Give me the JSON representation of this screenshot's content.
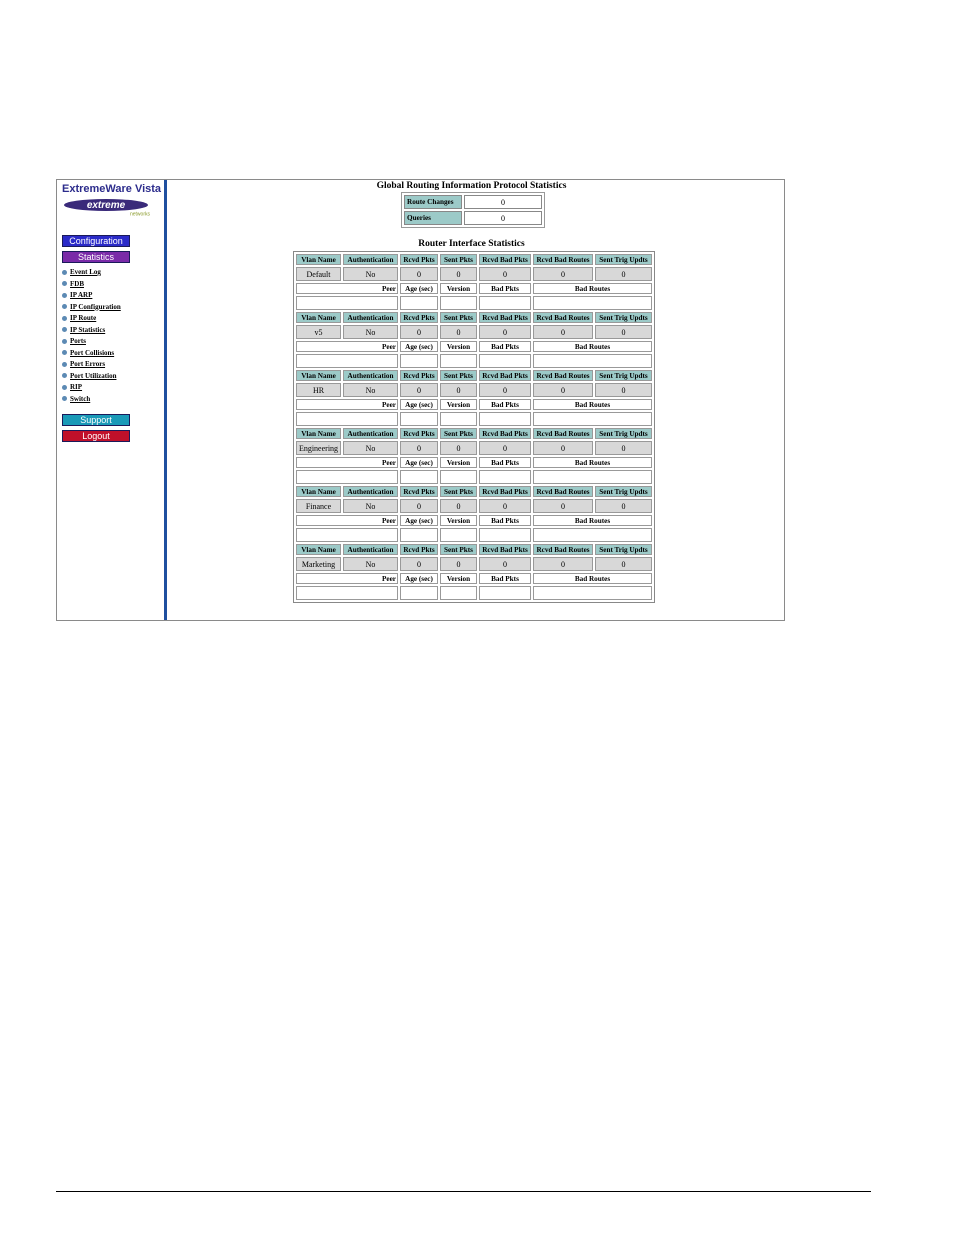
{
  "sidebar": {
    "brand": "ExtremeWare Vista",
    "logo_text": "extreme",
    "logo_sub": "networks",
    "configuration_label": "Configuration",
    "statistics_label": "Statistics",
    "support_label": "Support",
    "logout_label": "Logout",
    "items": [
      {
        "label": "Event Log"
      },
      {
        "label": "FDB"
      },
      {
        "label": "IP ARP"
      },
      {
        "label": "IP Configuration"
      },
      {
        "label": "IP Route"
      },
      {
        "label": "IP Statistics"
      },
      {
        "label": "Ports"
      },
      {
        "label": "Port Collisions"
      },
      {
        "label": "Port Errors"
      },
      {
        "label": "Port Utilization"
      },
      {
        "label": "RIP"
      },
      {
        "label": "Switch"
      }
    ]
  },
  "global": {
    "title": "Global Routing Information Protocol Statistics",
    "route_changes_label": "Route Changes",
    "route_changes_value": "0",
    "queries_label": "Queries",
    "queries_value": "0"
  },
  "router": {
    "title": "Router Interface Statistics",
    "headers": [
      "Vlan Name",
      "Authentication",
      "Rcvd Pkts",
      "Sent Pkts",
      "Rcvd Bad Pkts",
      "Rcvd Bad Routes",
      "Sent Trig Updts"
    ],
    "peer_headers": [
      "Peer",
      "Age (sec)",
      "Version",
      "Bad Pkts",
      "Bad Routes"
    ],
    "vlans": [
      {
        "name": "Default",
        "auth": "No",
        "rcvd": "0",
        "sent": "0",
        "bad_pkts": "0",
        "bad_routes": "0",
        "trig": "0"
      },
      {
        "name": "v5",
        "auth": "No",
        "rcvd": "0",
        "sent": "0",
        "bad_pkts": "0",
        "bad_routes": "0",
        "trig": "0"
      },
      {
        "name": "HR",
        "auth": "No",
        "rcvd": "0",
        "sent": "0",
        "bad_pkts": "0",
        "bad_routes": "0",
        "trig": "0"
      },
      {
        "name": "Engineering",
        "auth": "No",
        "rcvd": "0",
        "sent": "0",
        "bad_pkts": "0",
        "bad_routes": "0",
        "trig": "0"
      },
      {
        "name": "Finance",
        "auth": "No",
        "rcvd": "0",
        "sent": "0",
        "bad_pkts": "0",
        "bad_routes": "0",
        "trig": "0"
      },
      {
        "name": "Marketing",
        "auth": "No",
        "rcvd": "0",
        "sent": "0",
        "bad_pkts": "0",
        "bad_routes": "0",
        "trig": "0"
      }
    ]
  },
  "colors": {
    "header_teal": "#9ccac8",
    "divider_blue": "#1f4f9f",
    "configuration_blue": "#2a2ac8",
    "statistics_purple": "#7a2aa8",
    "support_cyan": "#1a9ab8",
    "logout_red": "#c0102a"
  }
}
